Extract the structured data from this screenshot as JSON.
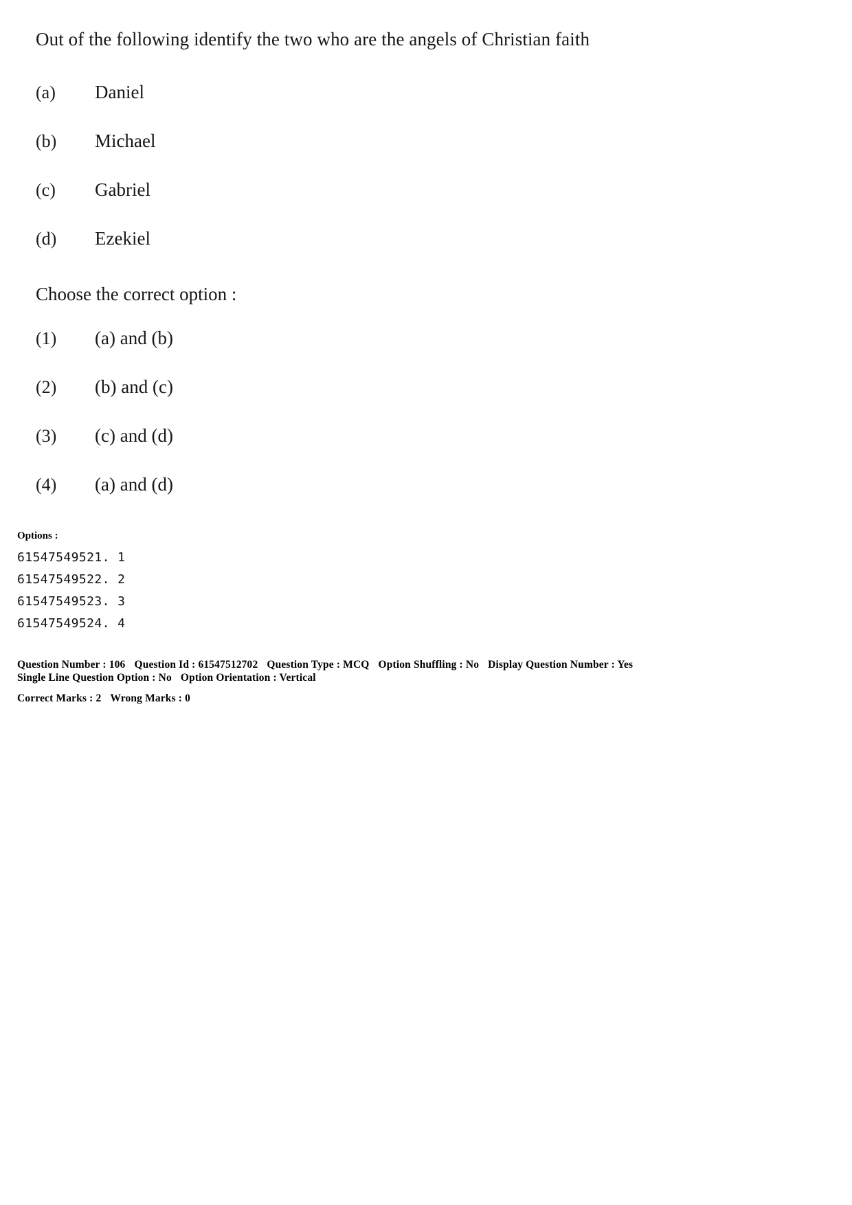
{
  "question": {
    "stem": "Out of the following identify the two who are the angels of Christian faith",
    "sub_options": [
      {
        "key": "(a)",
        "text": "Daniel"
      },
      {
        "key": "(b)",
        "text": "Michael"
      },
      {
        "key": "(c)",
        "text": "Gabriel"
      },
      {
        "key": "(d)",
        "text": "Ezekiel"
      }
    ],
    "choose_prompt": "Choose the correct option :",
    "answer_choices": [
      {
        "key": "(1)",
        "text": "(a) and (b)"
      },
      {
        "key": "(2)",
        "text": "(b) and (c)"
      },
      {
        "key": "(3)",
        "text": "(c) and (d)"
      },
      {
        "key": "(4)",
        "text": "(a) and (d)"
      }
    ]
  },
  "options_block": {
    "heading": "Options :",
    "ids": [
      "61547549521. 1",
      "61547549522. 2",
      "61547549523. 3",
      "61547549524. 4"
    ]
  },
  "metadata": {
    "line1": {
      "question_number": "Question Number : 106",
      "question_id": "Question Id : 61547512702",
      "question_type": "Question Type : MCQ",
      "option_shuffling": "Option Shuffling : No",
      "display_question_number": "Display Question Number : Yes"
    },
    "line2": {
      "single_line_question_option": "Single Line Question Option : No",
      "option_orientation": "Option Orientation : Vertical"
    },
    "line3": {
      "correct_marks": "Correct Marks : 2",
      "wrong_marks": "Wrong Marks : 0"
    }
  }
}
